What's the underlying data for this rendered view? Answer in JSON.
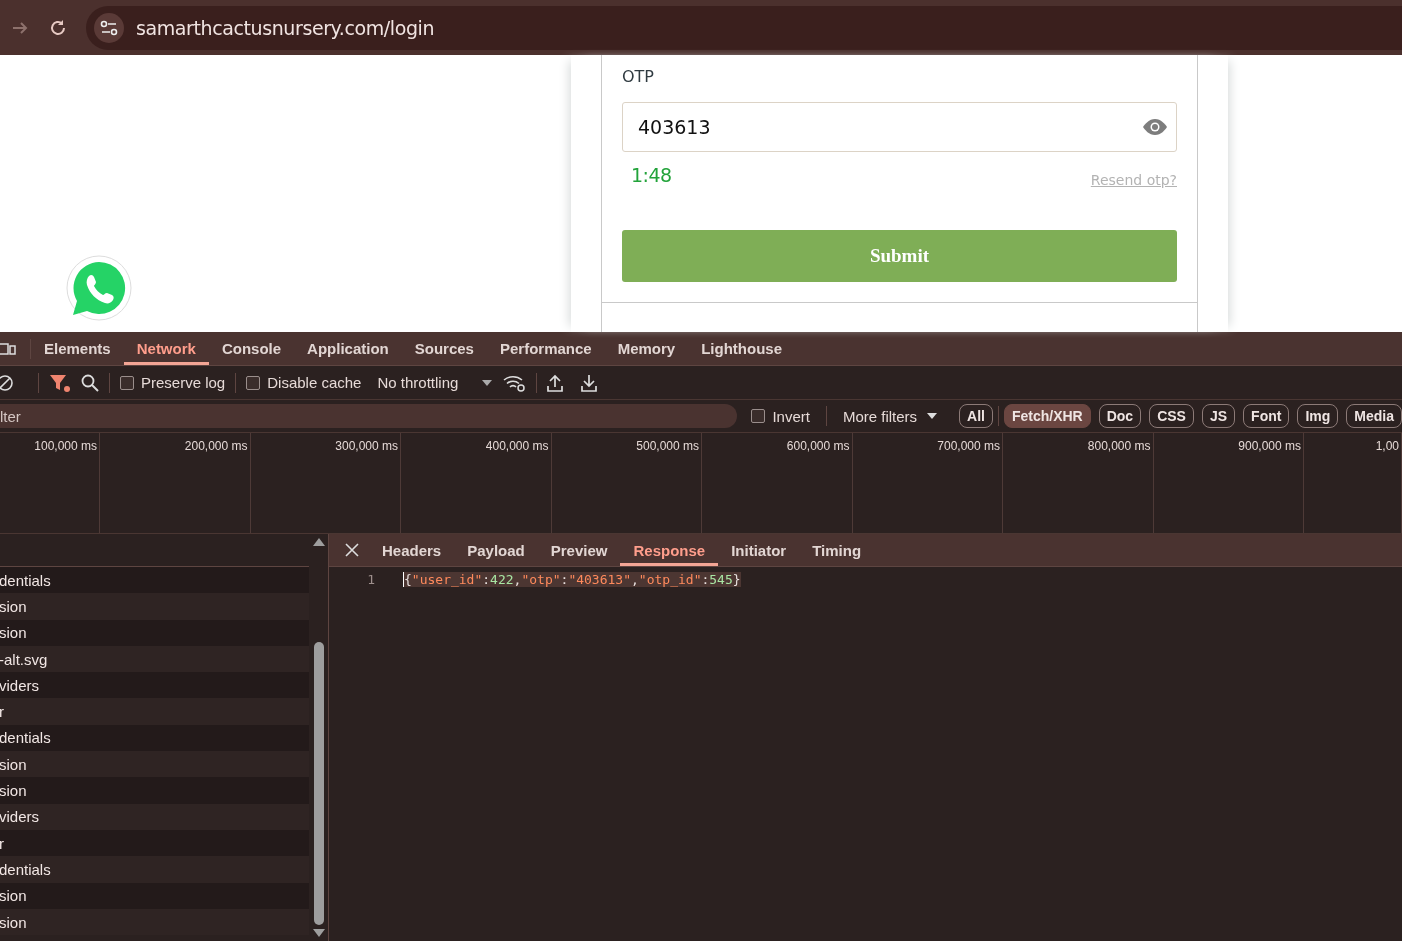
{
  "browser": {
    "url": "samarthcactusnursery.com/login"
  },
  "page": {
    "otp_label": "OTP",
    "otp_value": "403613",
    "timer": "1:48",
    "resend_link": "Resend otp?",
    "submit_button": "Submit"
  },
  "devtools": {
    "tabs": [
      {
        "label": "Elements",
        "selected": false
      },
      {
        "label": "Network",
        "selected": true
      },
      {
        "label": "Console",
        "selected": false
      },
      {
        "label": "Application",
        "selected": false
      },
      {
        "label": "Sources",
        "selected": false
      },
      {
        "label": "Performance",
        "selected": false
      },
      {
        "label": "Memory",
        "selected": false
      },
      {
        "label": "Lighthouse",
        "selected": false
      }
    ],
    "toolbar": {
      "filter_active": true,
      "preserve_log": {
        "label": "Preserve log",
        "checked": false
      },
      "disable_cache": {
        "label": "Disable cache",
        "checked": false
      },
      "throttling": "No throttling"
    },
    "filter": {
      "placeholder": "lter",
      "invert": {
        "label": "Invert",
        "checked": false
      },
      "more_filters": "More filters",
      "types": [
        {
          "label": "All",
          "selected": false
        },
        {
          "label": "Fetch/XHR",
          "selected": true
        },
        {
          "label": "Doc",
          "selected": false
        },
        {
          "label": "CSS",
          "selected": false
        },
        {
          "label": "JS",
          "selected": false
        },
        {
          "label": "Font",
          "selected": false
        },
        {
          "label": "Img",
          "selected": false
        },
        {
          "label": "Media",
          "selected": false
        }
      ]
    },
    "timeline": {
      "ticks": [
        "100,000 ms",
        "200,000 ms",
        "300,000 ms",
        "400,000 ms",
        "500,000 ms",
        "600,000 ms",
        "700,000 ms",
        "800,000 ms",
        "900,000 ms",
        "1,00"
      ]
    },
    "requests": [
      "dentials",
      "sion",
      "sion",
      "-alt.svg",
      "viders",
      "r",
      "dentials",
      "sion",
      "sion",
      "viders",
      "r",
      "dentials",
      "sion",
      "sion"
    ],
    "detail_tabs": [
      {
        "label": "Headers",
        "selected": false
      },
      {
        "label": "Payload",
        "selected": false
      },
      {
        "label": "Preview",
        "selected": false
      },
      {
        "label": "Response",
        "selected": true
      },
      {
        "label": "Initiator",
        "selected": false
      },
      {
        "label": "Timing",
        "selected": false
      }
    ],
    "response_lines": [
      {
        "number": "1",
        "text": "{\"user_id\":422,\"otp\":\"403613\",\"otp_id\":545}"
      }
    ]
  }
}
